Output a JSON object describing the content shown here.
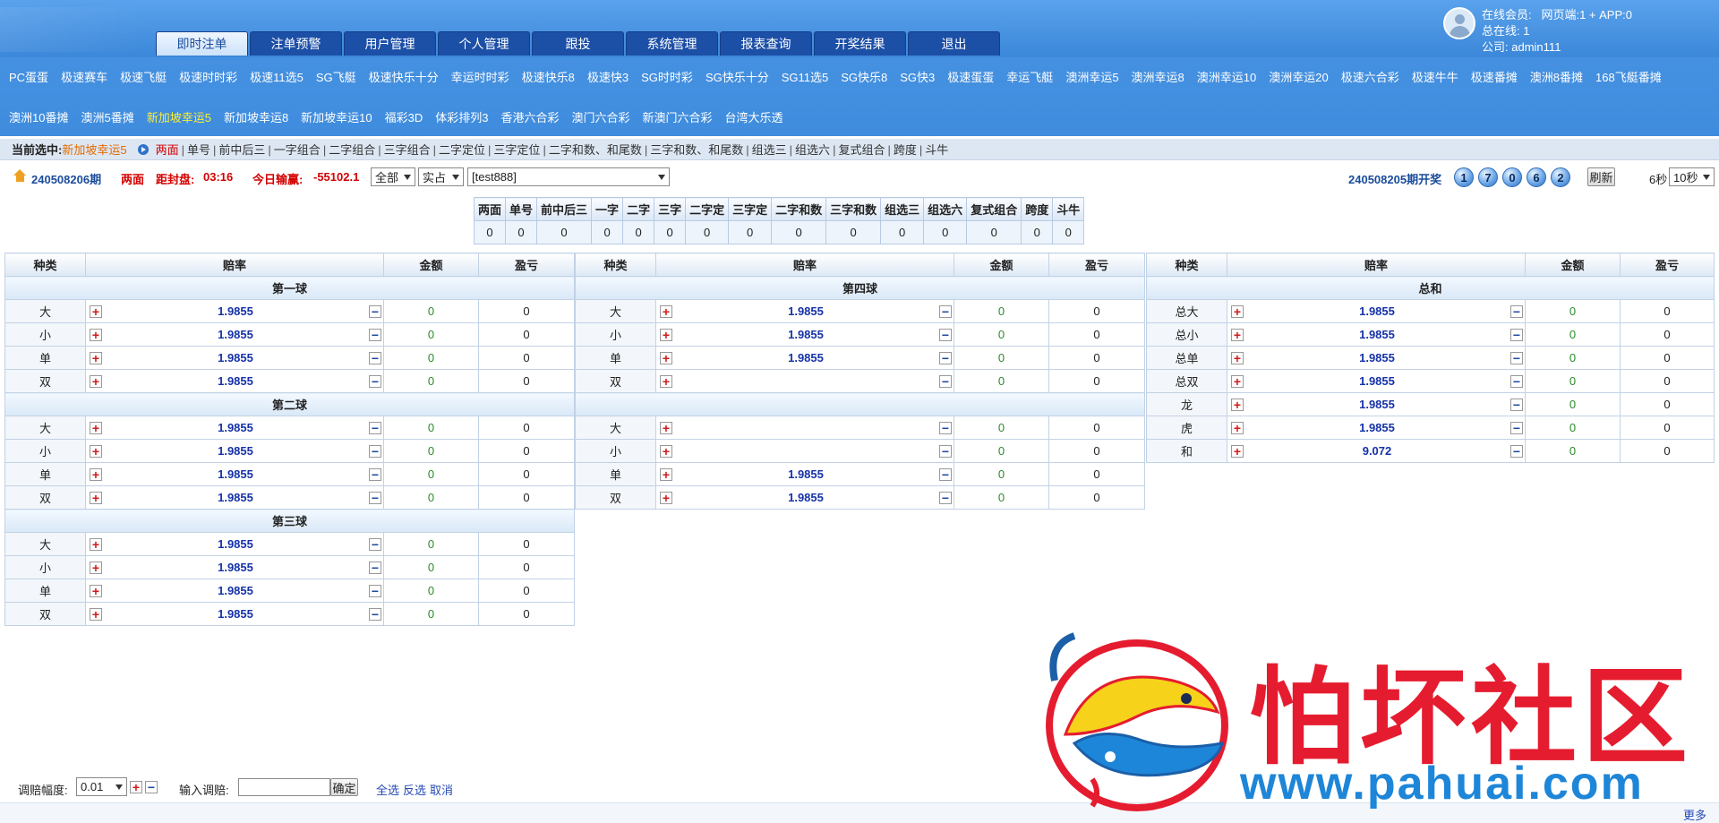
{
  "header": {
    "main_tabs": [
      {
        "label": "即时注单",
        "active": true
      },
      {
        "label": "注单预警"
      },
      {
        "label": "用户管理"
      },
      {
        "label": "个人管理"
      },
      {
        "label": "跟投"
      },
      {
        "label": "系统管理"
      },
      {
        "label": "报表查询"
      },
      {
        "label": "开奖结果"
      },
      {
        "label": "退出"
      }
    ],
    "user": {
      "online_members": "在线会员:",
      "online_members_value": "网页端:1 + APP:0",
      "total_online": "总在线:",
      "total_online_value": "1",
      "company": "公司:",
      "company_value": "admin111"
    },
    "lottery_row1": [
      "PC蛋蛋",
      "极速赛车",
      "极速飞艇",
      "极速时时彩",
      "极速11选5",
      "SG飞艇",
      "极速快乐十分",
      "幸运时时彩",
      "极速快乐8",
      "极速快3",
      "SG时时彩",
      "SG快乐十分",
      "SG11选5",
      "SG快乐8",
      "SG快3",
      "极速蛋蛋",
      "幸运飞艇",
      "澳洲幸运5",
      "澳洲幸运8",
      "澳洲幸运10",
      "澳洲幸运20",
      "极速六合彩",
      "极速牛牛",
      "极速番摊",
      "澳洲8番摊",
      "168飞艇番摊"
    ],
    "lottery_row2": [
      "澳洲10番摊",
      "澳洲5番摊",
      "新加坡幸运5",
      "新加坡幸运8",
      "新加坡幸运10",
      "福彩3D",
      "体彩排列3",
      "香港六合彩",
      "澳门六合彩",
      "新澳门六合彩",
      "台湾大乐透"
    ],
    "lottery_active": "新加坡幸运5"
  },
  "sub_bar": {
    "label": "当前选中:",
    "current": "新加坡幸运5",
    "links": [
      "两面",
      "单号",
      "前中后三",
      "一字组合",
      "二字组合",
      "三字组合",
      "二字定位",
      "三字定位",
      "二字和数、和尾数",
      "三字和数、和尾数",
      "组选三",
      "组选六",
      "复式组合",
      "跨度",
      "斗牛"
    ],
    "active": "两面"
  },
  "info_bar": {
    "period": "240508206期",
    "play": "两面",
    "close_label": "距封盘:",
    "close_value": "03:16",
    "profit_label": "今日输赢:",
    "profit_value": "-55102.1",
    "filter_all": "全部",
    "filter_mode": "实占",
    "user_select": "[test888]",
    "last_draw": "240508205期开奖",
    "balls": [
      "1",
      "7",
      "0",
      "6",
      "2"
    ],
    "refresh": "刷新",
    "seconds": "6秒",
    "interval": "10秒"
  },
  "summary": {
    "headers": [
      "两面",
      "单号",
      "前中后三",
      "一字",
      "二字",
      "三字",
      "二字定",
      "三字定",
      "二字和数",
      "三字和数",
      "组选三",
      "组选六",
      "复式组合",
      "跨度",
      "斗牛"
    ],
    "values": [
      "0",
      "0",
      "0",
      "0",
      "0",
      "0",
      "0",
      "0",
      "0",
      "0",
      "0",
      "0",
      "0",
      "0",
      "0"
    ]
  },
  "odds_headers": {
    "kind": "种类",
    "odds": "赔率",
    "amount": "金额",
    "pl": "盈亏"
  },
  "col1": [
    {
      "group": "第一球",
      "rows": [
        {
          "kind": "大",
          "odds": "1.9855",
          "amount": "0",
          "pl": "0"
        },
        {
          "kind": "小",
          "odds": "1.9855",
          "amount": "0",
          "pl": "0"
        },
        {
          "kind": "单",
          "odds": "1.9855",
          "amount": "0",
          "pl": "0"
        },
        {
          "kind": "双",
          "odds": "1.9855",
          "amount": "0",
          "pl": "0"
        }
      ]
    },
    {
      "group": "第二球",
      "rows": [
        {
          "kind": "大",
          "odds": "1.9855",
          "amount": "0",
          "pl": "0"
        },
        {
          "kind": "小",
          "odds": "1.9855",
          "amount": "0",
          "pl": "0"
        },
        {
          "kind": "单",
          "odds": "1.9855",
          "amount": "0",
          "pl": "0"
        },
        {
          "kind": "双",
          "odds": "1.9855",
          "amount": "0",
          "pl": "0"
        }
      ]
    },
    {
      "group": "第三球",
      "rows": [
        {
          "kind": "大",
          "odds": "1.9855",
          "amount": "0",
          "pl": "0"
        },
        {
          "kind": "小",
          "odds": "1.9855",
          "amount": "0",
          "pl": "0"
        },
        {
          "kind": "单",
          "odds": "1.9855",
          "amount": "0",
          "pl": "0"
        },
        {
          "kind": "双",
          "odds": "1.9855",
          "amount": "0",
          "pl": "0"
        }
      ]
    }
  ],
  "col2": [
    {
      "group": "第四球",
      "rows": [
        {
          "kind": "大",
          "odds": "1.9855",
          "amount": "0",
          "pl": "0"
        },
        {
          "kind": "小",
          "odds": "1.9855",
          "amount": "0",
          "pl": "0"
        },
        {
          "kind": "单",
          "odds": "1.9855",
          "amount": "0",
          "pl": "0"
        },
        {
          "kind": "双",
          "odds": "",
          "amount": "0",
          "pl": "0"
        }
      ]
    },
    {
      "group": "",
      "rows": [
        {
          "kind": "大",
          "odds": "",
          "amount": "0",
          "pl": "0"
        },
        {
          "kind": "小",
          "odds": "",
          "amount": "0",
          "pl": "0"
        },
        {
          "kind": "单",
          "odds": "1.9855",
          "amount": "0",
          "pl": "0"
        },
        {
          "kind": "双",
          "odds": "1.9855",
          "amount": "0",
          "pl": "0"
        }
      ]
    }
  ],
  "col3": [
    {
      "group": "总和",
      "rows": [
        {
          "kind": "总大",
          "odds": "1.9855",
          "amount": "0",
          "pl": "0"
        },
        {
          "kind": "总小",
          "odds": "1.9855",
          "amount": "0",
          "pl": "0"
        },
        {
          "kind": "总单",
          "odds": "1.9855",
          "amount": "0",
          "pl": "0"
        },
        {
          "kind": "总双",
          "odds": "1.9855",
          "amount": "0",
          "pl": "0"
        },
        {
          "kind": "龙",
          "odds": "1.9855",
          "amount": "0",
          "pl": "0"
        },
        {
          "kind": "虎",
          "odds": "1.9855",
          "amount": "0",
          "pl": "0"
        },
        {
          "kind": "和",
          "odds": "9.072",
          "amount": "0",
          "pl": "0"
        }
      ]
    }
  ],
  "bottom_bar": {
    "step_label": "调赔幅度:",
    "step_value": "0.01",
    "input_label": "输入调赔:",
    "confirm": "确定",
    "select_all": "全选",
    "invert": "反选",
    "cancel": "取消"
  },
  "footer": {
    "more": "更多"
  },
  "watermark": {
    "title": "怕坏社区",
    "url": "www.pahuai.com"
  },
  "colors": {
    "nav_bg": "#3f8cde",
    "tab_bg": "#1c4fa6",
    "odds": "#1632a8",
    "plus": "#d31a1a",
    "accent": "#e46b00"
  }
}
